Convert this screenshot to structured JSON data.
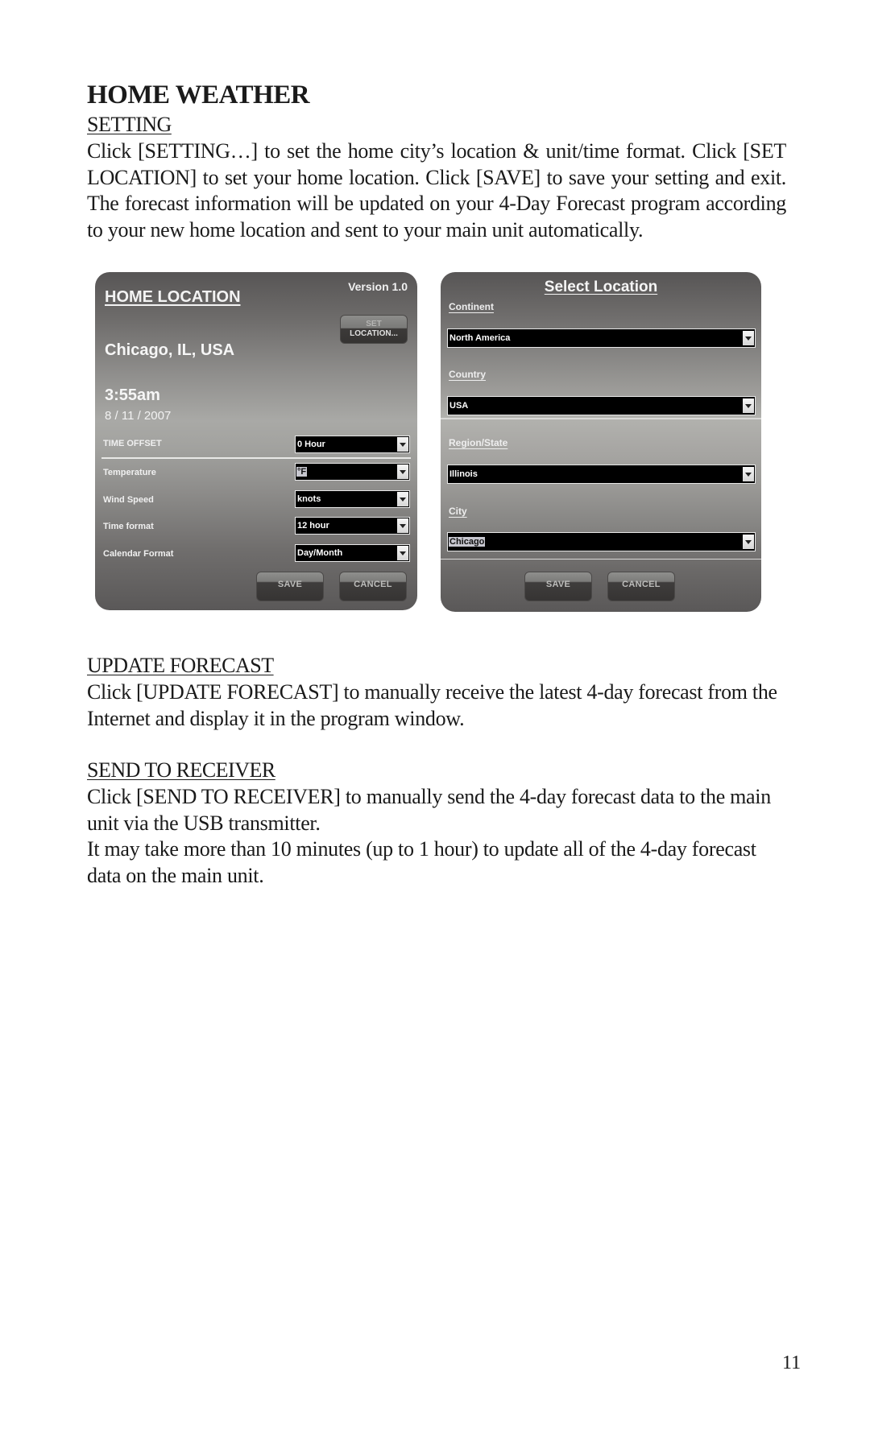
{
  "document": {
    "title": "HOME WEATHER",
    "page_number": "11",
    "sections": [
      {
        "heading": "SETTING",
        "paragraphs": [
          "Click [SETTING…] to set the home city’s location & unit/time format. Click [SET LOCATION] to set your home location. Click [SAVE] to save your setting and exit. The forecast information will be updated on your 4-Day Forecast program according to your new home location and sent to your main unit automatically."
        ]
      },
      {
        "heading": "UPDATE FORECAST",
        "paragraphs": [
          "Click [UPDATE FORECAST] to manually receive the latest 4-day forecast from the Internet and display it in the program window."
        ]
      },
      {
        "heading": "SEND TO RECEIVER",
        "paragraphs": [
          "Click [SEND TO RECEIVER] to manually send the 4-day forecast data to the main unit via the USB transmitter.",
          "It may take more than 10 minutes (up to 1 hour) to update all of the 4-day forecast data on the main unit."
        ]
      }
    ]
  },
  "home_location_panel": {
    "title": "HOME LOCATION",
    "version": "Version 1.0",
    "set_location_button": {
      "line1": "SET",
      "line2": "LOCATION..."
    },
    "city": "Chicago, IL, USA",
    "time": "3:55am",
    "date": "8 / 11 / 2007",
    "time_offset": {
      "label": "TIME OFFSET",
      "value": "0 Hour"
    },
    "settings": [
      {
        "label": "Temperature",
        "value": "°F"
      },
      {
        "label": "Wind Speed",
        "value": "knots"
      },
      {
        "label": "Time format",
        "value": "12 hour"
      },
      {
        "label": "Calendar Format",
        "value": "Day/Month"
      }
    ],
    "save_label": "SAVE",
    "cancel_label": "CANCEL"
  },
  "select_location_panel": {
    "title": "Select Location",
    "fields": [
      {
        "label": "Continent",
        "value": "North America"
      },
      {
        "label": "Country",
        "value": "USA"
      },
      {
        "label": "Region/State",
        "value": "Illinois"
      },
      {
        "label": "City",
        "value": "Chicago"
      }
    ],
    "save_label": "SAVE",
    "cancel_label": "CANCEL"
  },
  "colors": {
    "panel_dark": "#575555",
    "panel_light": "#aaa9a6",
    "dropdown_bg": "#000000",
    "selection_highlight": "#c7c7cf"
  }
}
